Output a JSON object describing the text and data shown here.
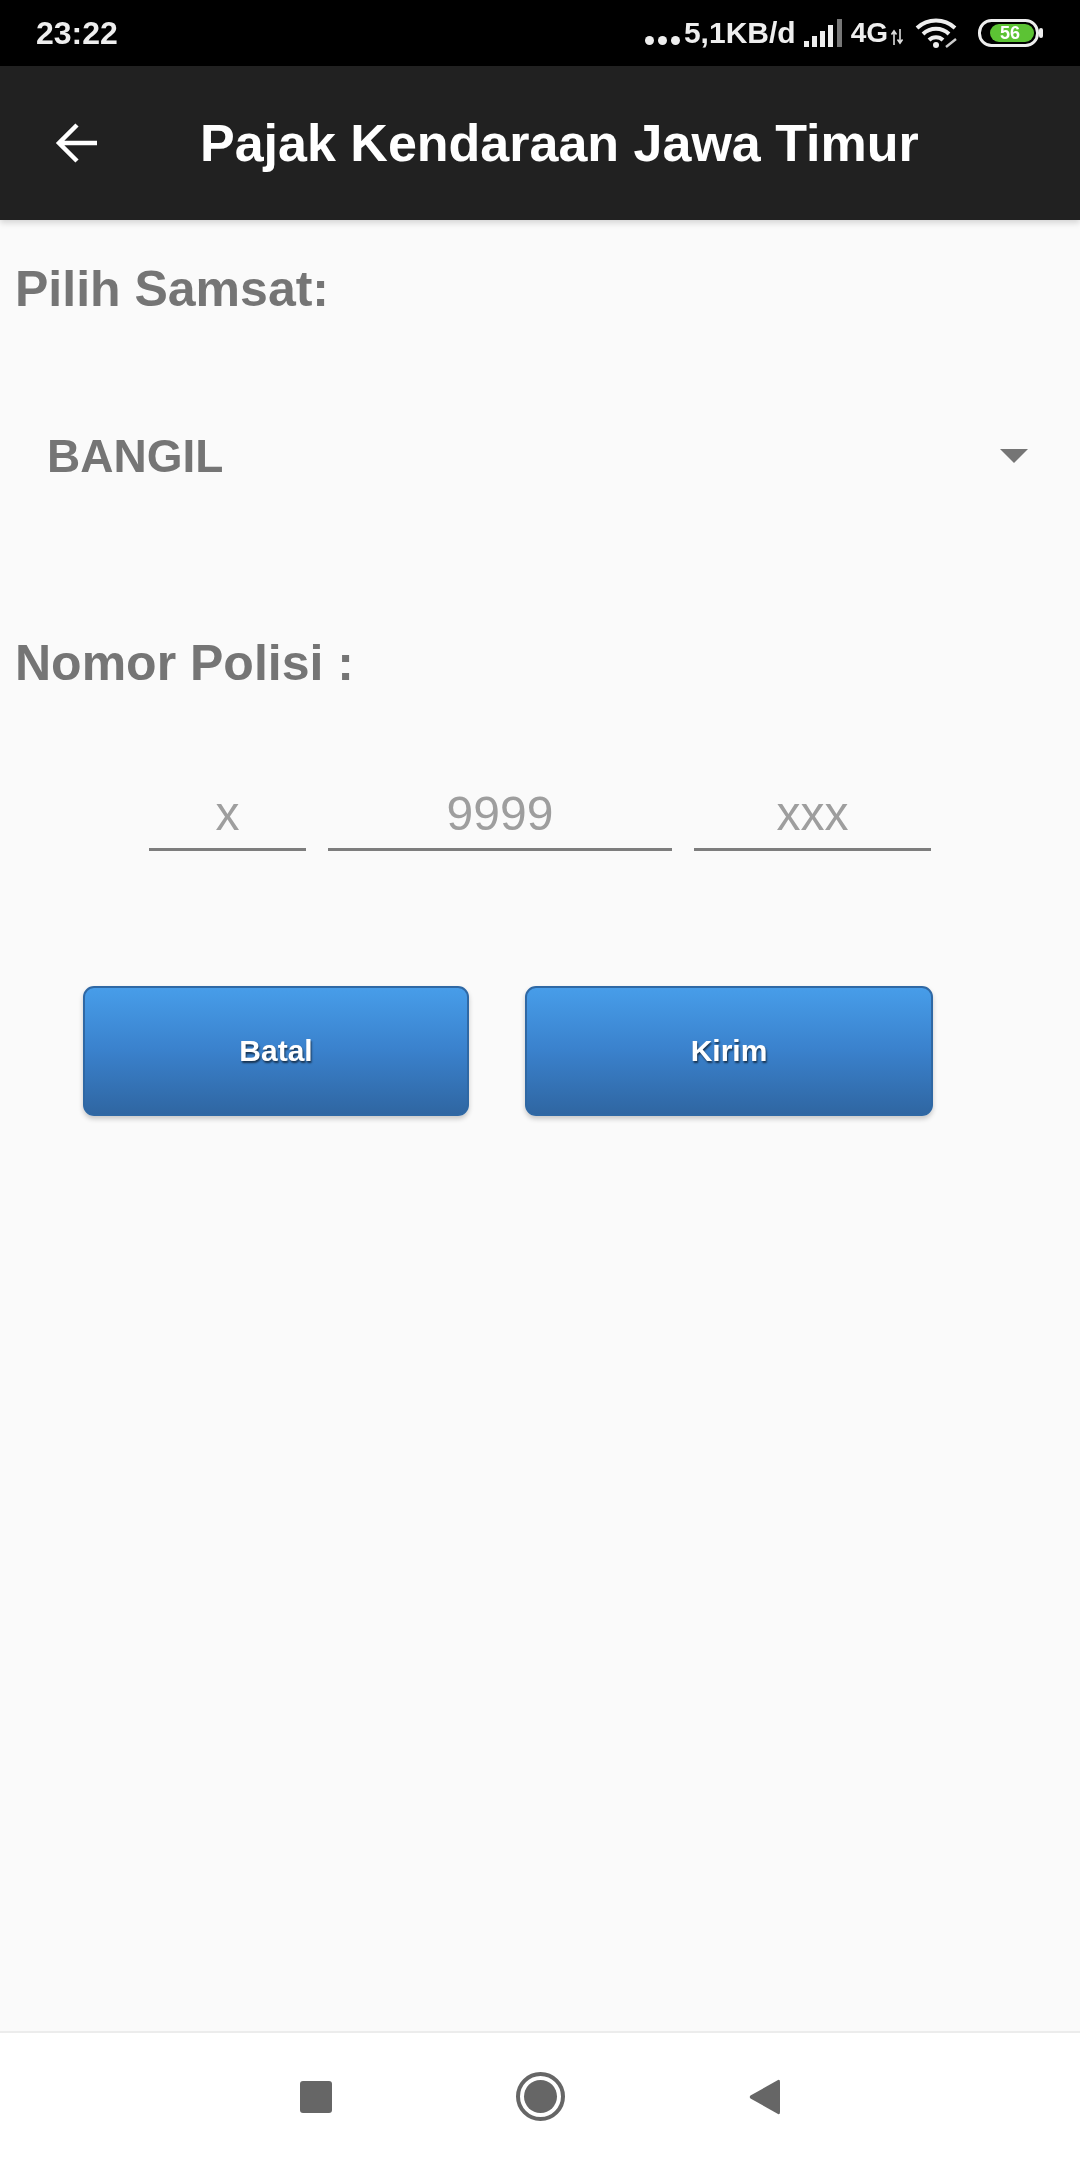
{
  "status_bar": {
    "time": "23:22",
    "network_speed": "5,1KB/d",
    "network_type": "4G",
    "battery_percent": "56"
  },
  "app_bar": {
    "title": "Pajak Kendaraan Jawa Timur"
  },
  "samsat": {
    "label": "Pilih Samsat:",
    "selected_value": "BANGIL"
  },
  "plate_number": {
    "label": "Nomor Polisi :",
    "fields": [
      {
        "placeholder": "x"
      },
      {
        "placeholder": "9999"
      },
      {
        "placeholder": "xxx"
      }
    ]
  },
  "buttons": [
    {
      "label": "Batal"
    },
    {
      "label": "Kirim"
    }
  ]
}
